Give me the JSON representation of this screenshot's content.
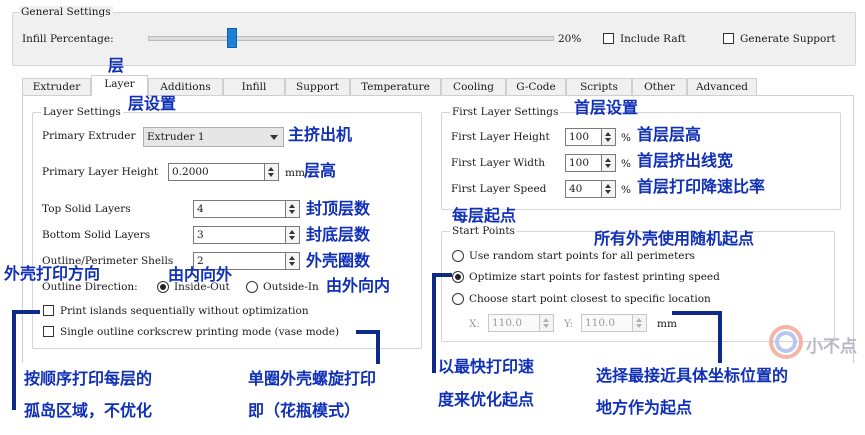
{
  "general": {
    "title": "General Settings",
    "infill_label": "Infill Percentage:",
    "infill_value": "20%",
    "infill_fraction": 0.2,
    "include_raft": "Include Raft",
    "generate_support": "Generate Support"
  },
  "tabs": [
    {
      "label": "Extruder"
    },
    {
      "label": "Layer"
    },
    {
      "label": "Additions"
    },
    {
      "label": "Infill"
    },
    {
      "label": "Support"
    },
    {
      "label": "Temperature"
    },
    {
      "label": "Cooling"
    },
    {
      "label": "G-Code"
    },
    {
      "label": "Scripts"
    },
    {
      "label": "Other"
    },
    {
      "label": "Advanced"
    }
  ],
  "layer_settings": {
    "title": "Layer Settings",
    "primary_extruder_label": "Primary Extruder",
    "primary_extruder_value": "Extruder 1",
    "primary_layer_height_label": "Primary Layer Height",
    "primary_layer_height_value": "0.2000",
    "unit_mm": "mm",
    "top_solid_layers_label": "Top Solid Layers",
    "top_solid_layers_value": "4",
    "bottom_solid_layers_label": "Bottom Solid Layers",
    "bottom_solid_layers_value": "3",
    "outline_shells_label": "Outline/Perimeter Shells",
    "outline_shells_value": "2",
    "outline_direction_label": "Outline Direction:",
    "inside_out": "Inside-Out",
    "outside_in": "Outside-In",
    "print_islands": "Print islands sequentially without optimization",
    "single_outline": "Single outline corkscrew printing mode (vase mode)"
  },
  "first_layer": {
    "title": "First Layer Settings",
    "height_label": "First Layer Height",
    "height_value": "100",
    "width_label": "First Layer Width",
    "width_value": "100",
    "speed_label": "First Layer Speed",
    "speed_value": "40",
    "pct": "%"
  },
  "start_points": {
    "title": "Start Points",
    "opt_random": "Use random start points for all perimeters",
    "opt_fastest": "Optimize start points for fastest printing speed",
    "opt_closest": "Choose start point closest to specific location",
    "x_label": "X:",
    "x_value": "110.0",
    "y_label": "Y:",
    "y_value": "110.0",
    "unit_mm": "mm"
  },
  "annotations": {
    "layer_tab": "层",
    "layer_settings": "层设置",
    "primary_extruder": "主挤出机",
    "layer_height": "层高",
    "top_layers": "封顶层数",
    "bottom_layers": "封底层数",
    "shells": "外壳圈数",
    "outline_direction": "外壳打印方向",
    "inside_out": "由内向外",
    "outside_in": "由外向内",
    "first_layer_settings": "首层设置",
    "first_layer_height": "首层层高",
    "first_layer_width": "首层挤出线宽",
    "first_layer_speed": "首层打印降速比率",
    "start_points": "每层起点",
    "random_start": "所有外壳使用随机起点",
    "islands_line1": "按顺序打印每层的",
    "islands_line2": "孤岛区域，不优化",
    "vase_line1": "单圈外壳螺旋打印",
    "vase_line2": "即（花瓶模式）",
    "fastest_line1": "以最快打印速",
    "fastest_line2": "度来优化起点",
    "closest_line1": "选择最接近具体坐标位置的",
    "closest_line2": "地方作为起点"
  },
  "watermark": "小不点",
  "colors": {
    "annotation_blue": "#1030b8",
    "slider_thumb": "#1e7fd6",
    "bracket": "#0d2a8a"
  }
}
